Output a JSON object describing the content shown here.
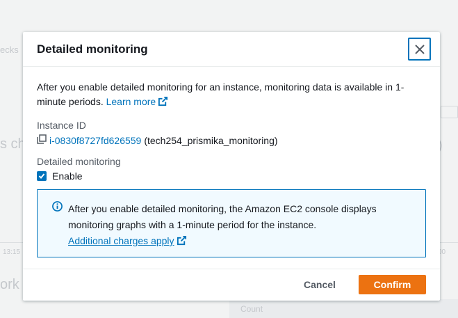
{
  "background": {
    "checks_text": "ecks",
    "check_large_text": "s che",
    "paren_text": ")",
    "time_left": "13:15",
    "time_right": "00",
    "work_text": "ork c",
    "count_text": "Count"
  },
  "modal": {
    "title": "Detailed monitoring",
    "description": "After you enable detailed monitoring for an instance, monitoring data is available in 1-minute periods.",
    "learn_more": "Learn more",
    "instance_label": "Instance ID",
    "instance_id": "i-0830f8727fd626559",
    "instance_name": "(tech254_prismika_monitoring)",
    "monitoring_label": "Detailed monitoring",
    "checkbox_label": "Enable",
    "checkbox_checked": true,
    "info_text": "After you enable detailed monitoring, the Amazon EC2 console displays monitoring graphs with a 1-minute period for the instance.",
    "info_link": "Additional charges apply",
    "cancel_label": "Cancel",
    "confirm_label": "Confirm"
  },
  "colors": {
    "link": "#0073bb",
    "primary_button": "#ec7211",
    "info_background": "#f1faff"
  },
  "icons": {
    "close": "close-icon",
    "external_link": "external-link-icon",
    "copy": "copy-icon",
    "check": "checkmark-icon",
    "info": "info-icon"
  }
}
